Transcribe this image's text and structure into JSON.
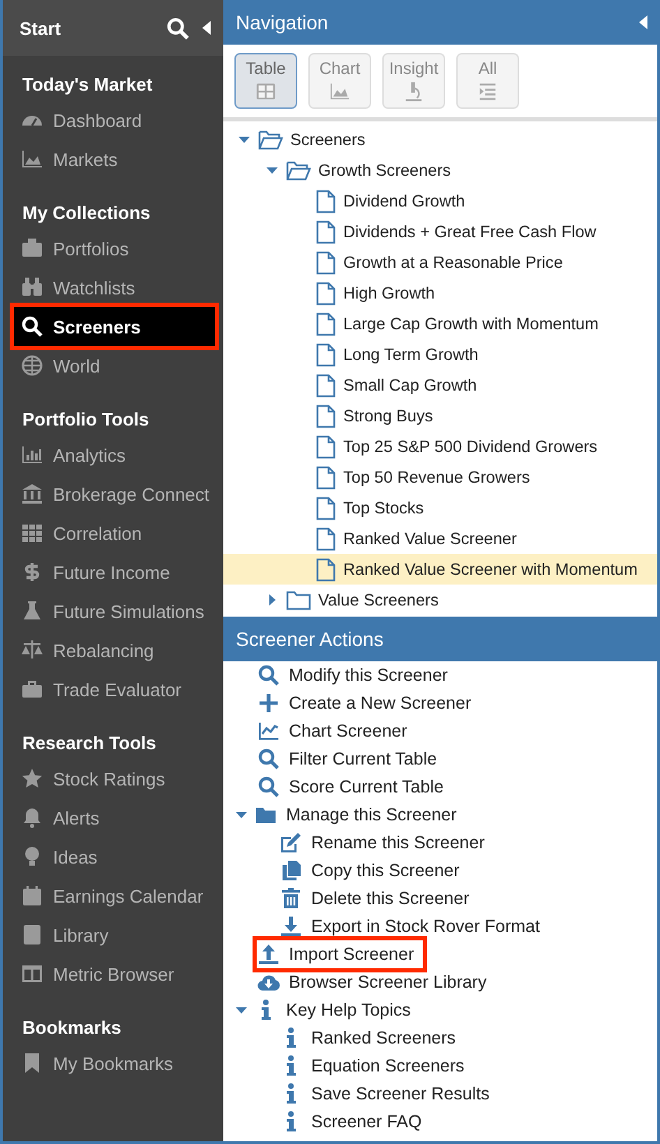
{
  "sidebar": {
    "title": "Start",
    "sections": [
      {
        "heading": "Today's Market",
        "items": [
          {
            "label": "Dashboard",
            "selected": false,
            "annotated": false
          },
          {
            "label": "Markets",
            "selected": false,
            "annotated": false
          }
        ]
      },
      {
        "heading": "My Collections",
        "items": [
          {
            "label": "Portfolios",
            "selected": false,
            "annotated": false
          },
          {
            "label": "Watchlists",
            "selected": false,
            "annotated": false
          },
          {
            "label": "Screeners",
            "selected": true,
            "annotated": true
          },
          {
            "label": "World",
            "selected": false,
            "annotated": false
          }
        ]
      },
      {
        "heading": "Portfolio Tools",
        "items": [
          {
            "label": "Analytics",
            "selected": false,
            "annotated": false
          },
          {
            "label": "Brokerage Connect",
            "selected": false,
            "annotated": false
          },
          {
            "label": "Correlation",
            "selected": false,
            "annotated": false
          },
          {
            "label": "Future Income",
            "selected": false,
            "annotated": false
          },
          {
            "label": "Future Simulations",
            "selected": false,
            "annotated": false
          },
          {
            "label": "Rebalancing",
            "selected": false,
            "annotated": false
          },
          {
            "label": "Trade Evaluator",
            "selected": false,
            "annotated": false
          }
        ]
      },
      {
        "heading": "Research Tools",
        "items": [
          {
            "label": "Stock Ratings",
            "selected": false,
            "annotated": false
          },
          {
            "label": "Alerts",
            "selected": false,
            "annotated": false
          },
          {
            "label": "Ideas",
            "selected": false,
            "annotated": false
          },
          {
            "label": "Earnings Calendar",
            "selected": false,
            "annotated": false
          },
          {
            "label": "Library",
            "selected": false,
            "annotated": false
          },
          {
            "label": "Metric Browser",
            "selected": false,
            "annotated": false
          }
        ]
      },
      {
        "heading": "Bookmarks",
        "items": [
          {
            "label": "My Bookmarks",
            "selected": false,
            "annotated": false
          }
        ]
      }
    ]
  },
  "navigation": {
    "title": "Navigation",
    "tabs": [
      {
        "label": "Table",
        "selected": true
      },
      {
        "label": "Chart",
        "selected": false
      },
      {
        "label": "Insight",
        "selected": false
      },
      {
        "label": "All",
        "selected": false
      }
    ],
    "tree": [
      {
        "kind": "folder",
        "label": "Screeners",
        "expanded": true,
        "selected": false,
        "children": [
          {
            "kind": "folder",
            "label": "Growth Screeners",
            "expanded": true,
            "selected": false,
            "children": [
              {
                "kind": "file",
                "label": "Dividend Growth",
                "selected": false
              },
              {
                "kind": "file",
                "label": "Dividends + Great Free Cash Flow",
                "selected": false
              },
              {
                "kind": "file",
                "label": "Growth at a Reasonable Price",
                "selected": false
              },
              {
                "kind": "file",
                "label": "High Growth",
                "selected": false
              },
              {
                "kind": "file",
                "label": "Large Cap Growth with Momentum",
                "selected": false
              },
              {
                "kind": "file",
                "label": "Long Term Growth",
                "selected": false
              },
              {
                "kind": "file",
                "label": "Small Cap Growth",
                "selected": false
              },
              {
                "kind": "file",
                "label": "Strong Buys",
                "selected": false
              },
              {
                "kind": "file",
                "label": "Top 25 S&P 500 Dividend Growers",
                "selected": false
              },
              {
                "kind": "file",
                "label": "Top 50 Revenue Growers",
                "selected": false
              },
              {
                "kind": "file",
                "label": "Top Stocks",
                "selected": false
              },
              {
                "kind": "file",
                "label": "Ranked Value Screener",
                "selected": false
              },
              {
                "kind": "file",
                "label": "Ranked Value Screener with Momentum",
                "selected": true
              }
            ]
          },
          {
            "kind": "folder",
            "label": "Value Screeners",
            "expanded": false,
            "selected": false
          }
        ]
      }
    ]
  },
  "actions": {
    "title": "Screener Actions",
    "items": [
      {
        "kind": "action",
        "label": "Modify this Screener",
        "annotated": false
      },
      {
        "kind": "action",
        "label": "Create a New Screener",
        "annotated": false
      },
      {
        "kind": "action",
        "label": "Chart Screener",
        "annotated": false
      },
      {
        "kind": "action",
        "label": "Filter Current Table",
        "annotated": false
      },
      {
        "kind": "action",
        "label": "Score Current Table",
        "annotated": false
      },
      {
        "kind": "group",
        "label": "Manage this Screener",
        "expanded": true,
        "annotated": false,
        "children": [
          {
            "kind": "action",
            "label": "Rename this Screener",
            "annotated": false
          },
          {
            "kind": "action",
            "label": "Copy this Screener",
            "annotated": false
          },
          {
            "kind": "action",
            "label": "Delete this Screener",
            "annotated": false
          },
          {
            "kind": "action",
            "label": "Export in Stock Rover Format",
            "annotated": false
          }
        ]
      },
      {
        "kind": "action",
        "label": "Import Screener",
        "annotated": true
      },
      {
        "kind": "action",
        "label": "Browser Screener Library",
        "annotated": false
      },
      {
        "kind": "group",
        "label": "Key Help Topics",
        "expanded": true,
        "annotated": false,
        "children": [
          {
            "kind": "action",
            "label": "Ranked Screeners",
            "annotated": false
          },
          {
            "kind": "action",
            "label": "Equation Screeners",
            "annotated": false
          },
          {
            "kind": "action",
            "label": "Save Screener Results",
            "annotated": false
          },
          {
            "kind": "action",
            "label": "Screener FAQ",
            "annotated": false
          }
        ]
      }
    ]
  }
}
